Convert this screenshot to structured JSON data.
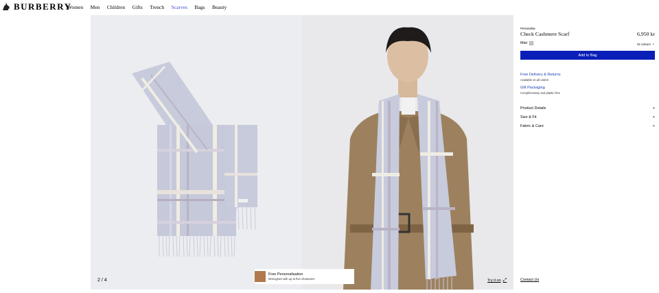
{
  "brand": {
    "name": "BURBERRY"
  },
  "nav": {
    "items": [
      "Women",
      "Men",
      "Children",
      "Gifts",
      "Trench",
      "Scarves",
      "Bags",
      "Beauty"
    ],
    "active": "Scarves"
  },
  "gallery": {
    "counter": "2 / 4"
  },
  "promo": {
    "title": "Free Personalisation",
    "subtitle": "Monogram with up to five characters"
  },
  "tryon": {
    "label": "Try it on"
  },
  "product": {
    "eyebrow": "Personalise",
    "title": "Check Cashmere Scarf",
    "price": "6,950 kr",
    "colour_label": "Mist",
    "colour_hex": "#c5c9d6",
    "colours_count": "32 colours",
    "add_to_bag": "Add to Bag"
  },
  "services": [
    {
      "title": "Free Delivery & Returns",
      "subtitle": "Available on all orders"
    },
    {
      "title": "Gift Packaging",
      "subtitle": "Complimentary and plastic-free"
    }
  ],
  "accordions": [
    {
      "label": "Product Details",
      "icon": "plus-icon"
    },
    {
      "label": "Size & Fit",
      "icon": "plus-icon"
    },
    {
      "label": "Fabric & Care",
      "icon": "plus-icon"
    }
  ],
  "contact": {
    "label": "Contact Us"
  }
}
